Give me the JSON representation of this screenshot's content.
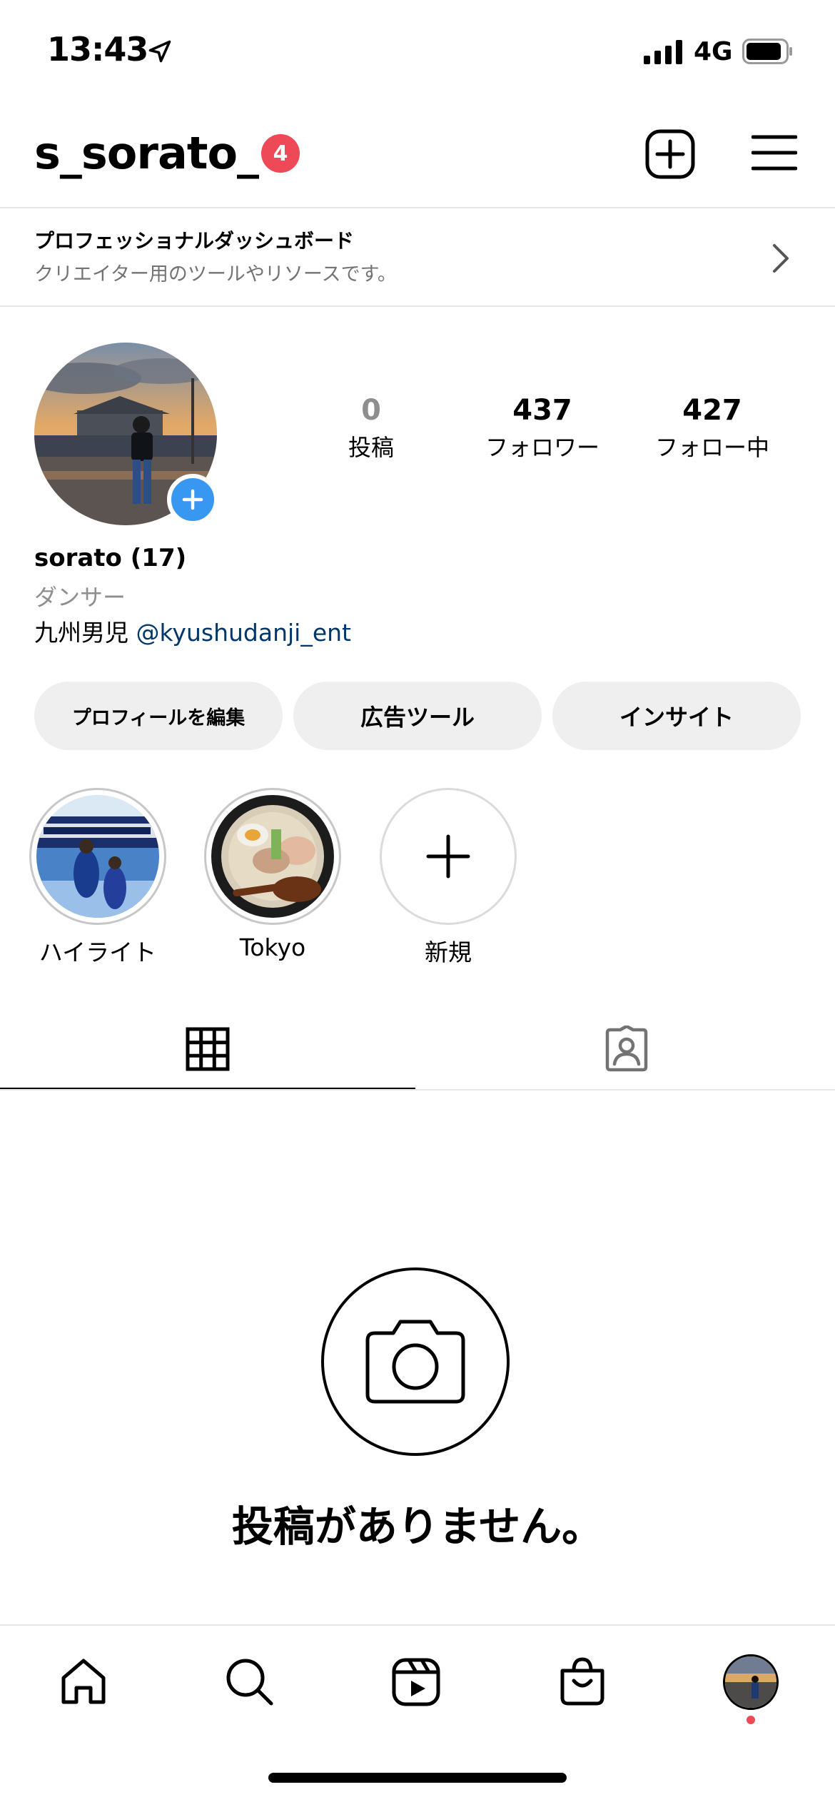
{
  "status_bar": {
    "time": "13:43",
    "network": "4G"
  },
  "header": {
    "username": "s_sorato_",
    "notification_count": "4"
  },
  "pro_dashboard": {
    "title": "プロフェッショナルダッシュボード",
    "subtitle": "クリエイター用のツールやリソースです。"
  },
  "stats": [
    {
      "value": "0",
      "label": "投稿"
    },
    {
      "value": "437",
      "label": "フォロワー"
    },
    {
      "value": "427",
      "label": "フォロー中"
    }
  ],
  "bio": {
    "name": "sorato (17)",
    "category": "ダンサー",
    "text": "九州男児",
    "mention": "@kyushudanji_ent"
  },
  "buttons": {
    "edit_profile": "プロフィールを編集",
    "ad_tools": "広告ツール",
    "insights": "インサイト"
  },
  "highlights": [
    {
      "label": "ハイライト"
    },
    {
      "label": "Tokyo"
    },
    {
      "label": "新規"
    }
  ],
  "empty_state": {
    "text": "投稿がありません。"
  },
  "colors": {
    "badge": "#ed4956",
    "link": "#00376b",
    "avatar_add": "#3897f0",
    "button_bg": "#efefef"
  },
  "icons": {
    "header": [
      "new-post-icon",
      "menu-icon"
    ],
    "tabs": [
      "grid-icon",
      "tagged-icon"
    ],
    "nav": [
      "home-icon",
      "search-icon",
      "reels-icon",
      "shop-icon",
      "profile-avatar"
    ]
  }
}
